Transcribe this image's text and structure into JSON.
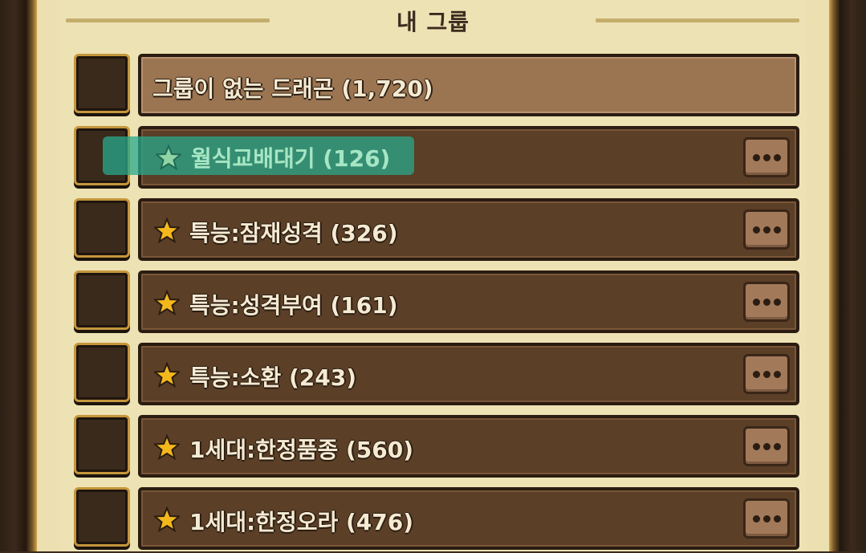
{
  "title": "내 그룹",
  "colors": {
    "panel": "#ede2b4",
    "bar": "#5b3f27",
    "bar_light": "#9b7551",
    "star": "#f4b81c",
    "highlight": "#28aa8c"
  },
  "groups": [
    {
      "label": "그룹이 없는 드래곤 (1,720)",
      "starred": false,
      "has_menu": false
    },
    {
      "label": "월식교배대기 (126)",
      "starred": true,
      "has_menu": true,
      "highlighted": true
    },
    {
      "label": "특능:잠재성격 (326)",
      "starred": true,
      "has_menu": true
    },
    {
      "label": "특능:성격부여 (161)",
      "starred": true,
      "has_menu": true
    },
    {
      "label": "특능:소환 (243)",
      "starred": true,
      "has_menu": true
    },
    {
      "label": "1세대:한정품종 (560)",
      "starred": true,
      "has_menu": true
    },
    {
      "label": "1세대:한정오라 (476)",
      "starred": true,
      "has_menu": true
    }
  ],
  "icons": {
    "star": "star-icon",
    "more": "more-options-icon"
  }
}
